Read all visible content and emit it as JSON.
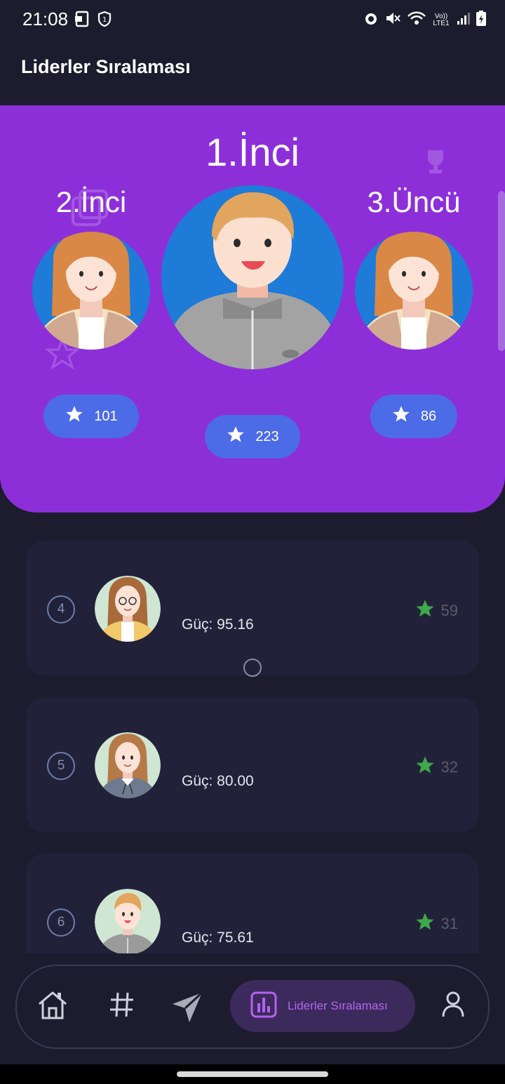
{
  "status_bar": {
    "time": "21:08",
    "left_icons": [
      "screen-mirror-icon",
      "shield-icon"
    ],
    "right_icons": [
      "alarm-icon",
      "mute-icon",
      "wifi-icon",
      "volte-icon",
      "signal-icon",
      "battery-icon"
    ],
    "volte_text": "Vo)) LTE1"
  },
  "header": {
    "title": "Liderler Sıralaması"
  },
  "podium": {
    "first": {
      "title": "1.İnci",
      "score": "223"
    },
    "second": {
      "title": "2.İnci",
      "score": "101"
    },
    "third": {
      "title": "3.Üncü",
      "score": "86"
    }
  },
  "leaderboard": [
    {
      "rank": "4",
      "power": "Güç: 95.16",
      "score": "59"
    },
    {
      "rank": "5",
      "power": "Güç: 80.00",
      "score": "32"
    },
    {
      "rank": "6",
      "power": "Güç: 75.61",
      "score": "31"
    }
  ],
  "bottom_nav": {
    "items": [
      "home-icon",
      "hashtag-icon",
      "send-icon",
      "leaderboard-icon",
      "profile-icon"
    ],
    "active_label": "Liderler Sıralaması"
  },
  "colors": {
    "background": "#1c1c2e",
    "podium": "#8d2fd9",
    "score_pill": "#4c6be7",
    "card": "#22213a",
    "star_green": "#3fa84a",
    "accent": "#b164f0"
  }
}
